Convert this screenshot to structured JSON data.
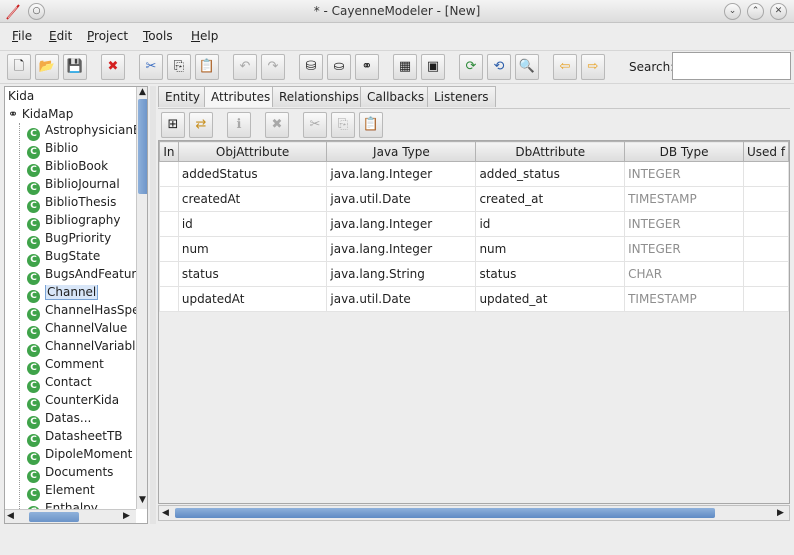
{
  "window": {
    "title": "* - CayenneModeler - [New]",
    "controls": [
      "chevron-down-icon",
      "chevron-up-icon",
      "close-icon"
    ]
  },
  "menu": {
    "file": "File",
    "edit": "Edit",
    "project": "Project",
    "tools": "Tools",
    "help": "Help"
  },
  "toolbar": {
    "search_label": "Search:",
    "search_value": "",
    "icons": [
      "new-project-icon",
      "open-project-icon",
      "save-icon",
      "remove-icon",
      "cut-icon",
      "copy-icon",
      "paste-icon",
      "undo-icon",
      "redo-icon",
      "create-datanode-icon",
      "create-datamap-icon",
      "create-entity-icon",
      "create-procedure-icon",
      "create-query-icon",
      "generate-db-icon",
      "generate-classes-icon",
      "search-icon",
      "back-icon",
      "forward-icon"
    ]
  },
  "tree": {
    "root": "Kida",
    "map": "KidaMap",
    "selected": "Channel",
    "nodes": [
      "AstrophysicianB",
      "Biblio",
      "BiblioBook",
      "BiblioJournal",
      "BiblioThesis",
      "Bibliography",
      "BugPriority",
      "BugState",
      "BugsAndFeatur",
      "Channel",
      "ChannelHasSpe",
      "ChannelValue",
      "ChannelVariabl",
      "Comment",
      "Contact",
      "CounterKida",
      "Datas...",
      "DatasheetTB",
      "DipoleMoment",
      "Documents",
      "Element",
      "Enthalpy"
    ]
  },
  "tabs": [
    "Entity",
    "Attributes",
    "Relationships",
    "Callbacks",
    "Listeners"
  ],
  "active_tab": "Attributes",
  "attributes_table": {
    "columns": [
      "In",
      "ObjAttribute",
      "Java Type",
      "DbAttribute",
      "DB Type",
      "Used f"
    ],
    "rows": [
      [
        "",
        "addedStatus",
        "java.lang.Integer",
        "added_status",
        "INTEGER",
        ""
      ],
      [
        "",
        "createdAt",
        "java.util.Date",
        "created_at",
        "TIMESTAMP",
        ""
      ],
      [
        "",
        "id",
        "java.lang.Integer",
        "id",
        "INTEGER",
        ""
      ],
      [
        "",
        "num",
        "java.lang.Integer",
        "num",
        "INTEGER",
        ""
      ],
      [
        "",
        "status",
        "java.lang.String",
        "status",
        "CHAR",
        ""
      ],
      [
        "",
        "updatedAt",
        "java.util.Date",
        "updated_at",
        "TIMESTAMP",
        ""
      ]
    ]
  },
  "colors": {
    "accent": "#6b93c8",
    "entity_icon": "#3fa34a",
    "remove": "#d42020"
  }
}
